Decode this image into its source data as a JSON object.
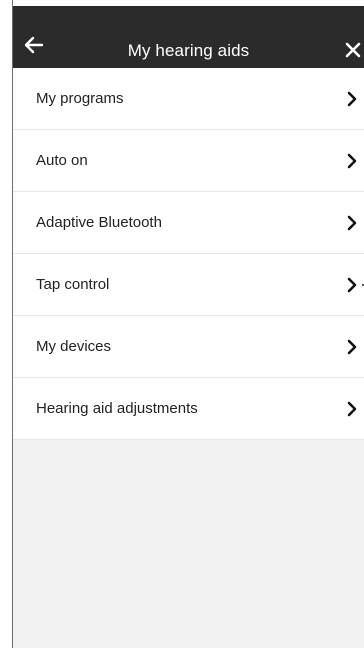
{
  "header": {
    "title": "My hearing aids",
    "back_icon": "arrow-left-icon",
    "close_icon": "close-icon"
  },
  "menu": {
    "items": [
      {
        "label": "My programs",
        "icon": "chevron-right-icon"
      },
      {
        "label": "Auto on",
        "icon": "chevron-right-icon"
      },
      {
        "label": "Adaptive Bluetooth",
        "icon": "chevron-right-icon"
      },
      {
        "label": "Tap control",
        "icon": "chevron-right-icon"
      },
      {
        "label": "My devices",
        "icon": "chevron-right-icon"
      },
      {
        "label": "Hearing aid adjustments",
        "icon": "chevron-right-icon"
      }
    ]
  },
  "colors": {
    "header_bg": "#2b2b2b",
    "list_bg": "#ffffff",
    "page_bg": "#f2f2f2",
    "text": "#222222"
  }
}
